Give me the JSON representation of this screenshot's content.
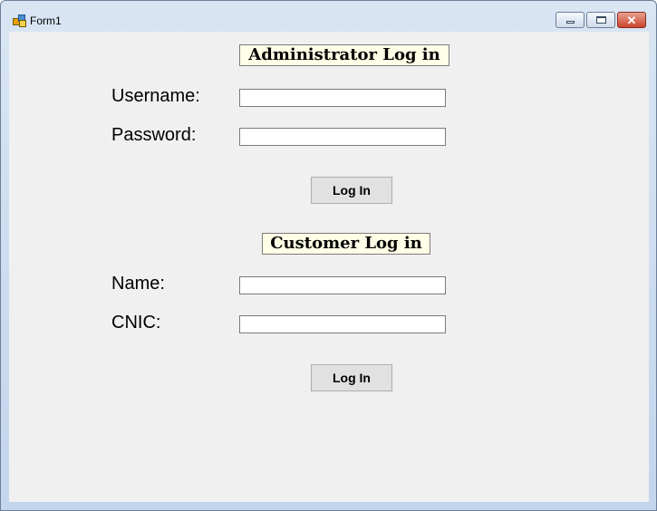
{
  "window": {
    "title": "Form1",
    "controls": {
      "minimize": "minimize-icon",
      "maximize": "maximize-icon",
      "close": "close-icon"
    }
  },
  "admin": {
    "heading": "Administrator Log in",
    "username_label": "Username:",
    "username_value": "",
    "password_label": "Password:",
    "password_value": "",
    "login_button": "Log In"
  },
  "customer": {
    "heading": "Customer Log in",
    "name_label": "Name:",
    "name_value": "",
    "cnic_label": "CNIC:",
    "cnic_value": "",
    "login_button": "Log In"
  },
  "colors": {
    "heading_bg": "#fffee6",
    "form_bg": "#f0f0f0",
    "close_button": "#c9452e"
  }
}
